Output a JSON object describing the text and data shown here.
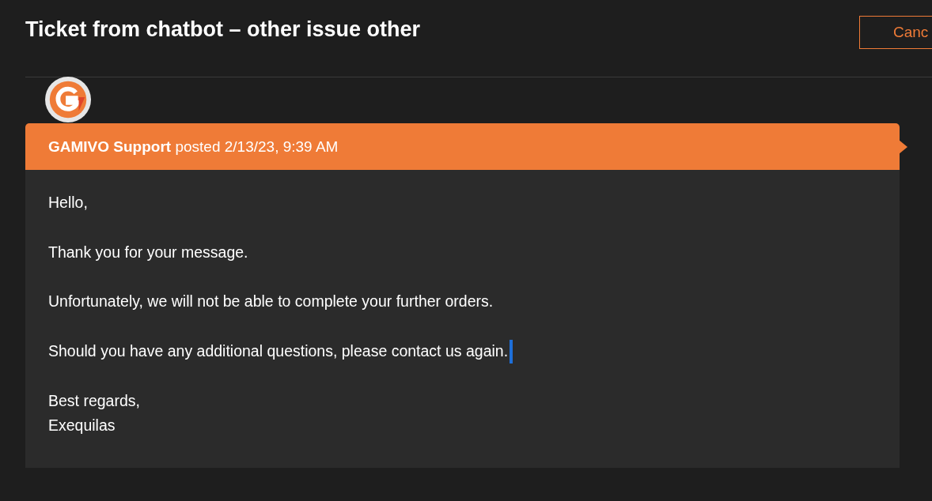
{
  "title": "Ticket from chatbot – other issue other",
  "cancel_button": "Canc",
  "message": {
    "header": "**GAMIVO Support** posted 2/13/23, 9:39 AM",
    "paragraphs": [
      "Hello,",
      "Thank you for your message.",
      "Unfortunately, we will not be able to complete your further orders.",
      "Should you have any additional questions, please contact us again."
    ],
    "signature": [
      "Best regards,",
      "Exequilas"
    ]
  }
}
